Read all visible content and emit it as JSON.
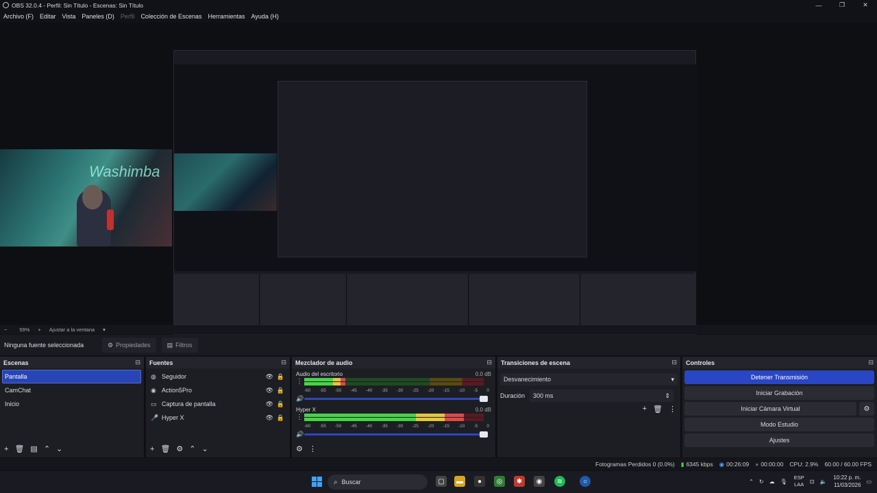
{
  "window": {
    "title": "OBS 32.0.4 - Perfil: Sin Título - Escenas: Sin Título",
    "controls": {
      "minimize": "—",
      "maximize": "❐",
      "close": "✕"
    }
  },
  "menu": {
    "file": "Archivo (F)",
    "edit": "Editar",
    "view": "Vista",
    "docks": "Paneles (D)",
    "profile": "Perfil",
    "scene_collection": "Colección de Escenas",
    "tools": "Herramientas",
    "help": "Ayuda (H)"
  },
  "preview": {
    "camera_sign": "Washimba"
  },
  "zoom": {
    "minus": "−",
    "level": "59%",
    "plus": "+",
    "fit": "Ajustar a la ventana",
    "caret": "▾"
  },
  "context": {
    "no_source": "Ninguna fuente seleccionada",
    "properties": "Propiedades",
    "filters": "Filtros",
    "properties_icon": "⚙",
    "filters_icon": "▤"
  },
  "scenes": {
    "title": "Escenas",
    "items": [
      "Pantalla",
      "CamChat",
      "Inicio"
    ]
  },
  "sources": {
    "title": "Fuentes",
    "items": [
      {
        "name": "Seguidor",
        "icon": "◍"
      },
      {
        "name": "Action5Pro",
        "icon": "◉"
      },
      {
        "name": "Captura de pantalla",
        "icon": "▭"
      },
      {
        "name": "Hyper X",
        "icon": "🎤"
      }
    ],
    "eye": "👁",
    "lock": "🔒"
  },
  "mixer": {
    "title": "Mezclador de audio",
    "channels": [
      {
        "name": "Audio del escritorio",
        "db": "0.0 dB",
        "level_top": 0.23,
        "level_bottom": 0.23
      },
      {
        "name": "Hyper X",
        "db": "0.0 dB",
        "level_top": 0.89,
        "level_bottom": 0.89
      }
    ],
    "scale": [
      "-60",
      "-55",
      "-50",
      "-45",
      "-40",
      "-35",
      "-30",
      "-25",
      "-20",
      "-15",
      "-10",
      "-5",
      "0"
    ]
  },
  "transitions": {
    "title": "Transiciones de escena",
    "selected": "Desvanecimiento",
    "duration_label": "Duración",
    "duration_value": "300 ms"
  },
  "controls": {
    "title": "Controles",
    "stop_stream": "Detener Transmisión",
    "start_record": "Iniciar Grabación",
    "start_vcam": "Iniciar Cámara Virtual",
    "studio_mode": "Modo Estudio",
    "settings": "Ajustes"
  },
  "dock_icon": "⊟",
  "status": {
    "dropped": "Fotogramas Perdidos 0 (0.0%)",
    "bitrate": "6345 kbps",
    "live_time": "00:26:09",
    "rec_time": "00:00:00",
    "cpu": "CPU: 2.9%",
    "fps": "60.00 / 60.00 FPS"
  },
  "taskbar": {
    "search": "Buscar",
    "lang_top": "ESP",
    "lang_bottom": "LAA",
    "time": "10:22 p. m.",
    "date": "11/03/2026"
  },
  "colors": {
    "accent": "#2a46c4",
    "meter_green": "#45d545",
    "meter_yellow": "#e5c83a",
    "meter_red": "#e04848"
  }
}
